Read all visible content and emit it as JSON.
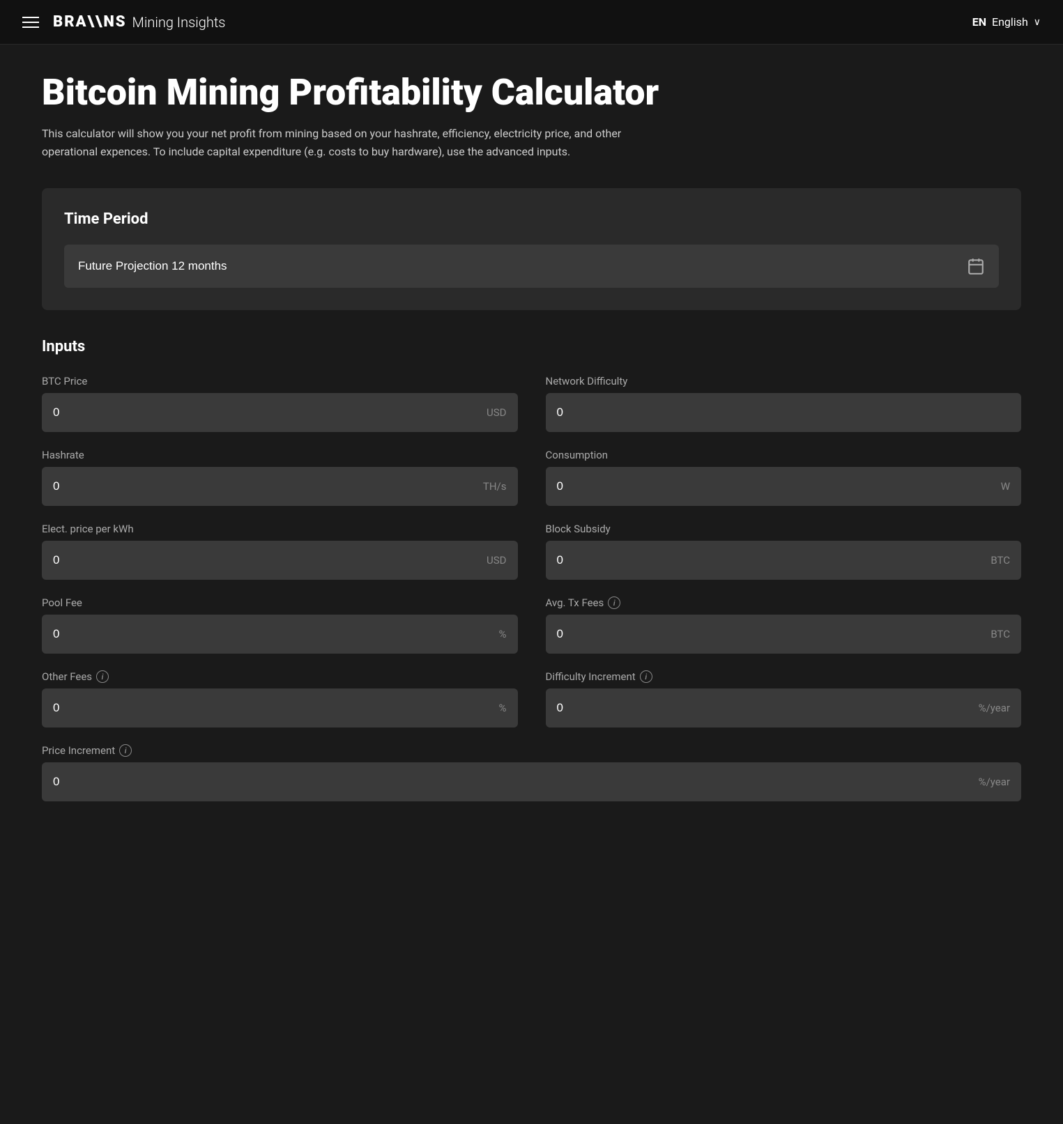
{
  "navbar": {
    "hamburger_label": "menu",
    "logo_brand": "BRA\\\\NS",
    "logo_subtitle": "Mining Insights",
    "lang_code": "EN",
    "lang_name": "English",
    "lang_chevron": "∨"
  },
  "page": {
    "title": "Bitcoin Mining Profitability Calculator",
    "description": "This calculator will show you your net profit from mining based on your hashrate, efficiency, electricity price, and other operational expences. To include capital expenditure (e.g. costs to buy hardware), use the advanced inputs."
  },
  "time_period": {
    "section_title": "Time Period",
    "selected_value": "Future Projection 12 months"
  },
  "inputs": {
    "section_title": "Inputs",
    "fields": [
      {
        "id": "btc-price",
        "label": "BTC Price",
        "value": "0",
        "unit": "USD",
        "info": false,
        "full_width": false
      },
      {
        "id": "network-difficulty",
        "label": "Network Difficulty",
        "value": "0",
        "unit": "",
        "info": false,
        "full_width": false
      },
      {
        "id": "hashrate",
        "label": "Hashrate",
        "value": "0",
        "unit": "TH/s",
        "info": false,
        "full_width": false
      },
      {
        "id": "consumption",
        "label": "Consumption",
        "value": "0",
        "unit": "W",
        "info": false,
        "full_width": false
      },
      {
        "id": "elec-price",
        "label": "Elect. price per kWh",
        "value": "0",
        "unit": "USD",
        "info": false,
        "full_width": false
      },
      {
        "id": "block-subsidy",
        "label": "Block Subsidy",
        "value": "0",
        "unit": "BTC",
        "info": false,
        "full_width": false
      },
      {
        "id": "pool-fee",
        "label": "Pool Fee",
        "value": "0",
        "unit": "%",
        "info": false,
        "full_width": false
      },
      {
        "id": "avg-tx-fees",
        "label": "Avg. Tx Fees",
        "value": "0",
        "unit": "BTC",
        "info": true,
        "full_width": false
      },
      {
        "id": "other-fees",
        "label": "Other Fees",
        "value": "0",
        "unit": "%",
        "info": true,
        "full_width": false
      },
      {
        "id": "difficulty-increment",
        "label": "Difficulty Increment",
        "value": "0",
        "unit": "%/year",
        "info": true,
        "full_width": false
      },
      {
        "id": "price-increment",
        "label": "Price Increment",
        "value": "0",
        "unit": "%/year",
        "info": true,
        "full_width": true
      }
    ]
  }
}
